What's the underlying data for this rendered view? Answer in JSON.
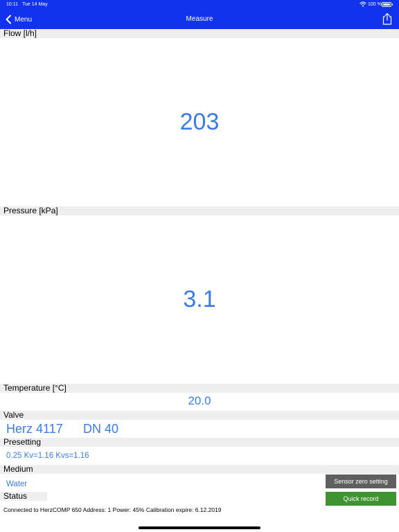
{
  "status_bar": {
    "time": "10:11",
    "date": "Tue 14 May",
    "battery": "100 %"
  },
  "nav": {
    "back_label": "Menu",
    "title": "Measure"
  },
  "flow": {
    "label": "Flow [l/h]",
    "value": "203"
  },
  "pressure": {
    "label": "Pressure [kPa]",
    "value": "3.1"
  },
  "temperature": {
    "label": "Temperature [°C]",
    "value": "20.0"
  },
  "valve": {
    "label": "Valve",
    "name": "Herz 4117",
    "size": "DN 40"
  },
  "presetting": {
    "label": "Presetting",
    "value": "0.25 Kv=1.16 Kvs=1.16"
  },
  "medium": {
    "label": "Medium",
    "value": "Water"
  },
  "status": {
    "label": "Status"
  },
  "buttons": {
    "sensor_zero": "Sensor zero setting",
    "quick_record": "Quick record"
  },
  "footer": {
    "connection": "Connected to HerzCOMP 650 Address: 1 Power: 45% Calibration expire: 6.12.2019"
  },
  "colors": {
    "header": "#1133ee",
    "value": "#3a7be8",
    "section_bar": "#eeeeef",
    "button_gray": "#5f5f5f",
    "button_green": "#3f9431"
  }
}
